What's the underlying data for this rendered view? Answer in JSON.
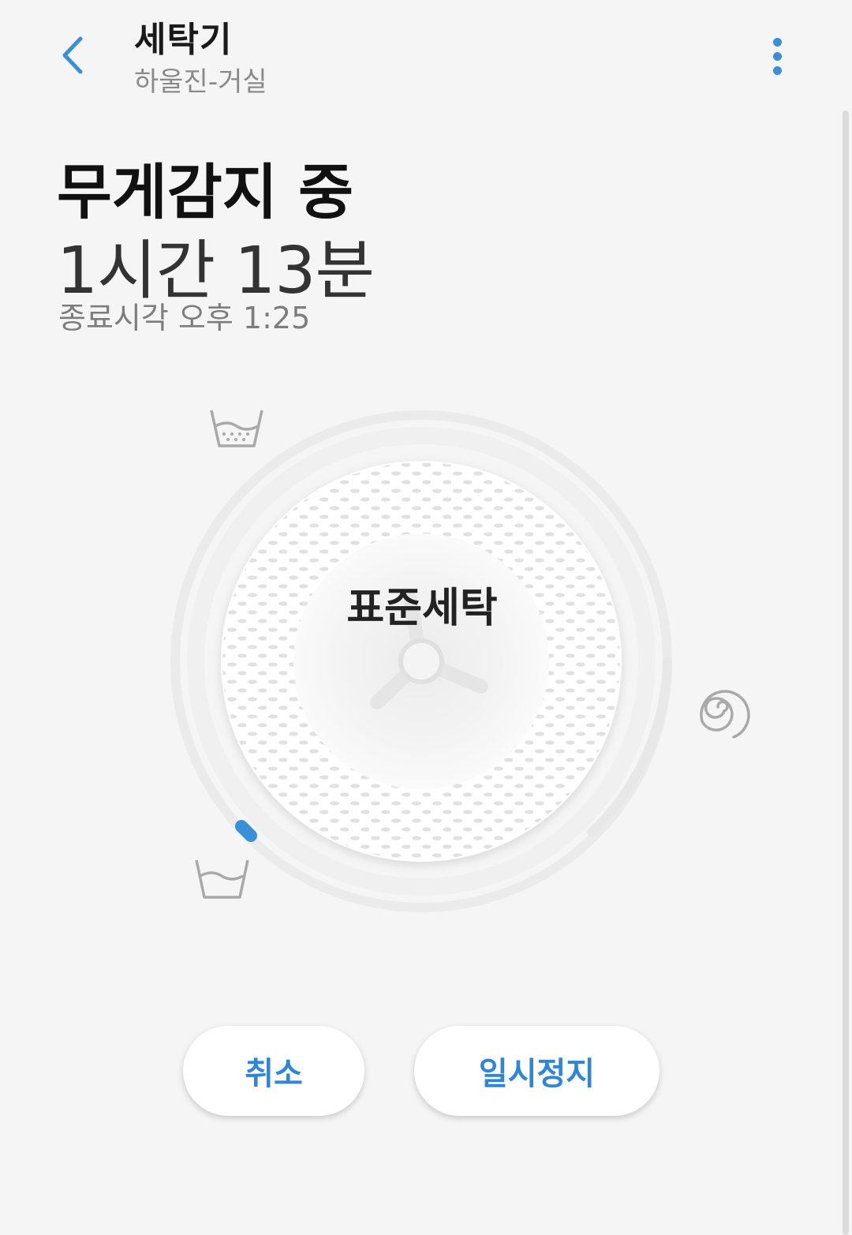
{
  "header": {
    "title": "세탁기",
    "subtitle": "하울진-거실"
  },
  "status": {
    "title": "무게감지 중",
    "time_remaining": "1시간 13분",
    "end_time": "종료시각 오후 1:25"
  },
  "dial": {
    "course": "표준세탁",
    "progress_fraction": 0.02
  },
  "buttons": {
    "cancel": "취소",
    "pause": "일시정지"
  },
  "colors": {
    "accent": "#3a8fd9",
    "background": "#f5f5f5"
  },
  "icons": {
    "back": "chevron-left-icon",
    "more": "more-vertical-icon",
    "wash": "wash-basin-icon",
    "rinse": "water-basin-icon",
    "spin": "spin-spiral-icon"
  }
}
